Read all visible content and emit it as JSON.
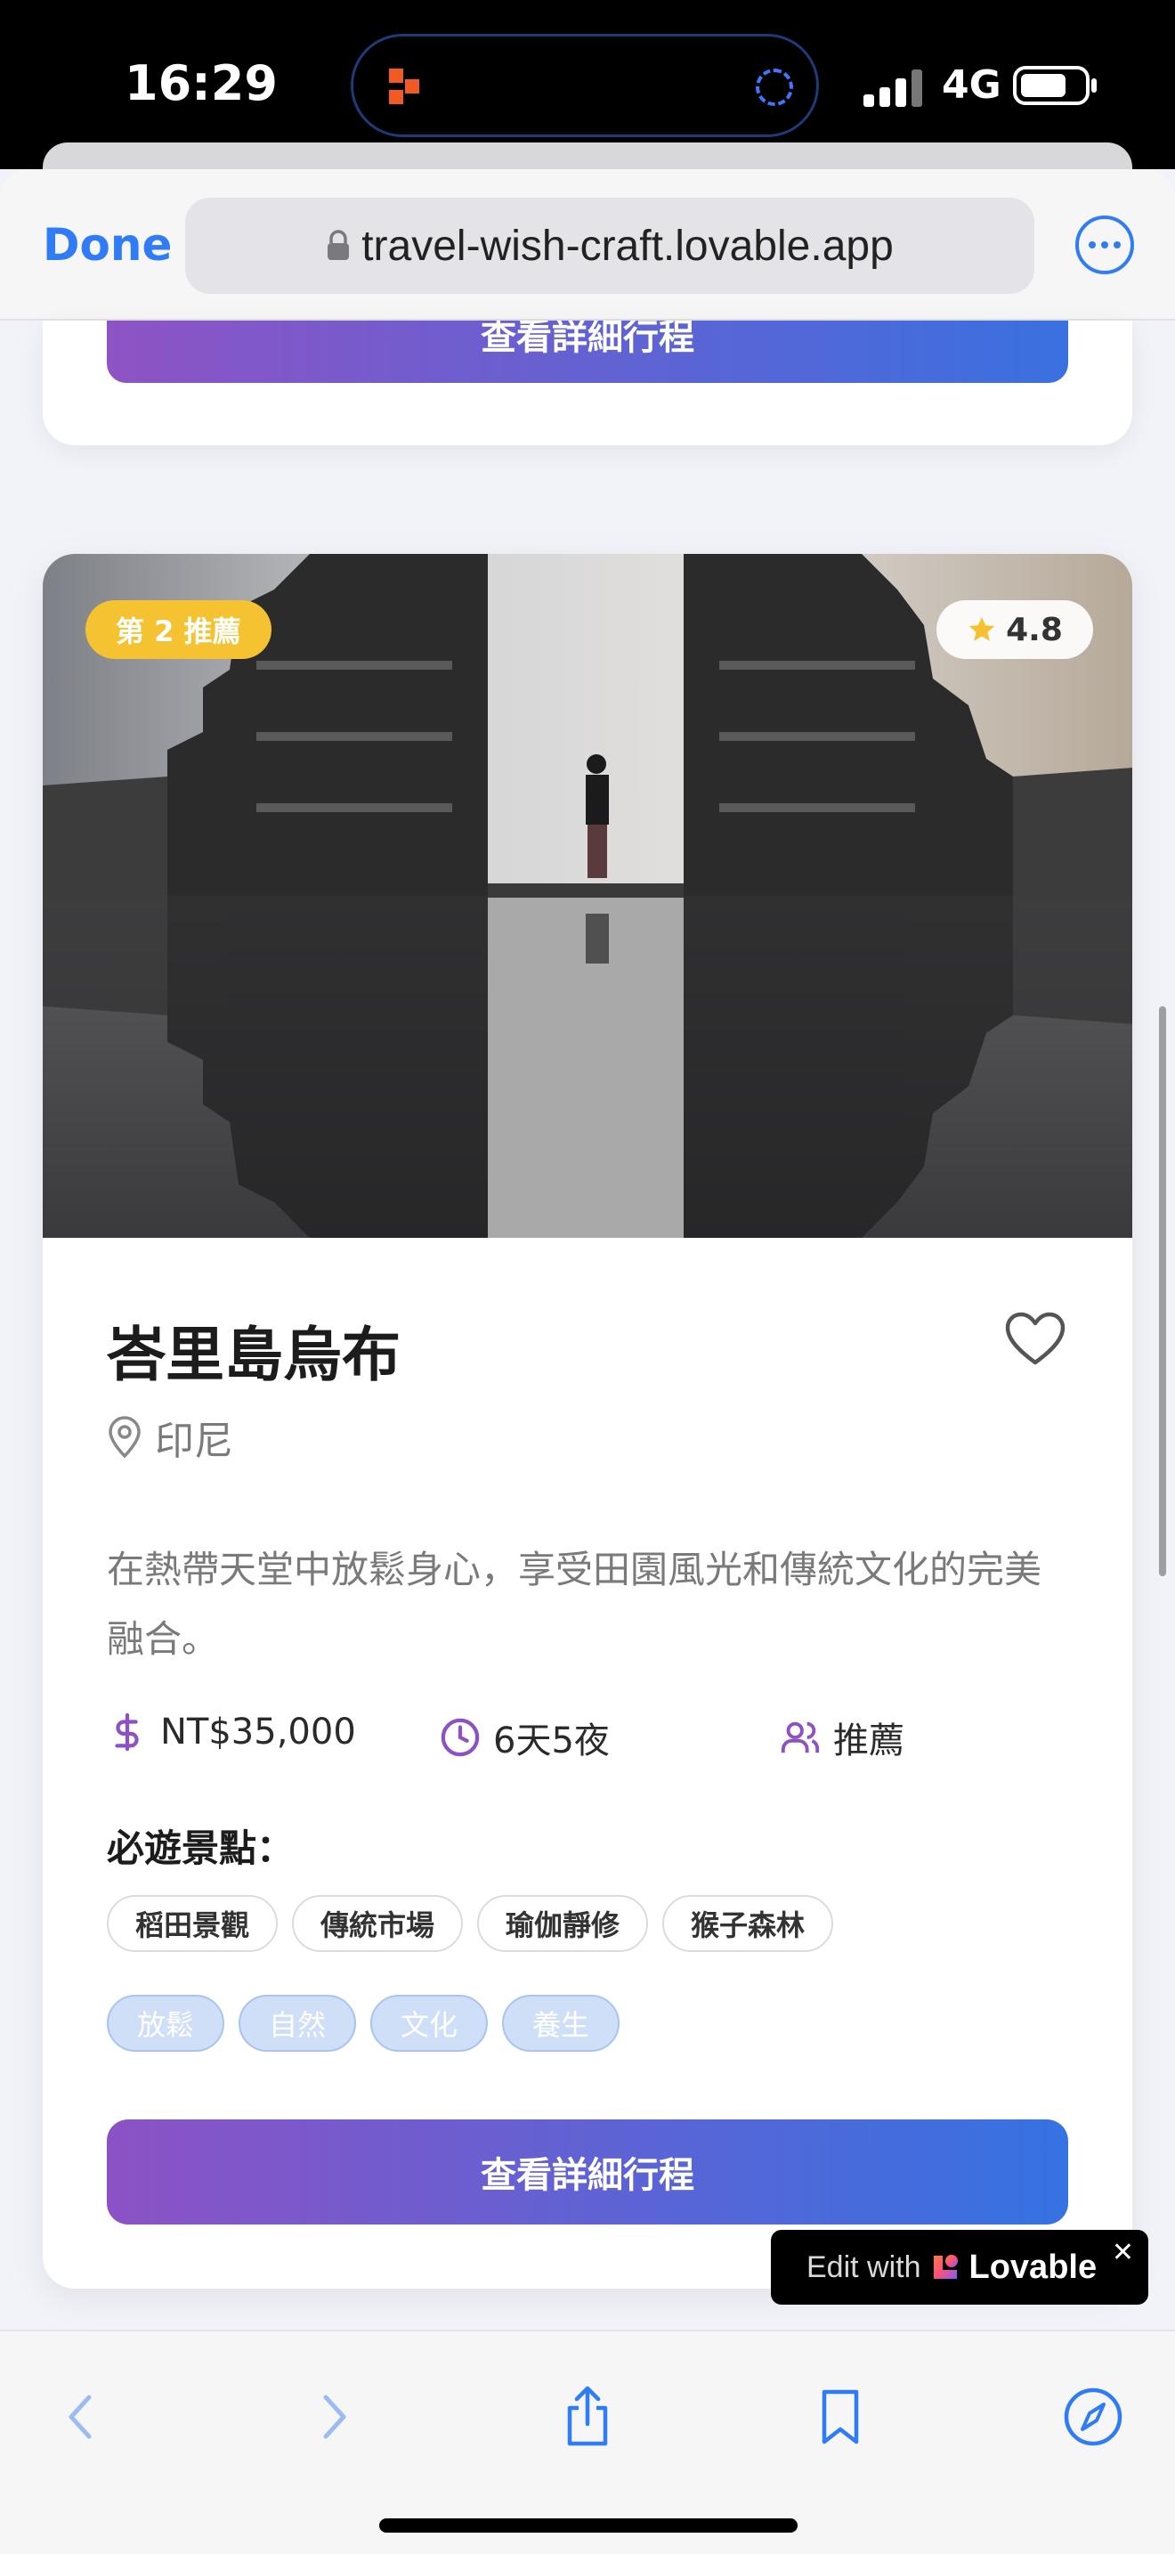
{
  "status_bar": {
    "time": "16:29",
    "network": "4G"
  },
  "browser": {
    "done_label": "Done",
    "url": "travel-wish-craft.lovable.app"
  },
  "previous_card": {
    "button_label": "查看詳細行程"
  },
  "card": {
    "rank_badge": "第 2 推薦",
    "rating": "4.8",
    "title": "峇里島烏布",
    "location": "印尼",
    "description": "在熱帶天堂中放鬆身心，享受田園風光和傳統文化的完美融合。",
    "price": "NT$35,000",
    "duration": "6天5夜",
    "audience": "推薦",
    "spots_title": "必遊景點：",
    "spots": [
      "稻田景觀",
      "傳統市場",
      "瑜伽靜修",
      "猴子森林"
    ],
    "tags": [
      "放鬆",
      "自然",
      "文化",
      "養生"
    ],
    "cta_label": "查看詳細行程"
  },
  "lovable_badge": {
    "edit_text": "Edit with",
    "brand": "Lovable",
    "close": "✕"
  },
  "colors": {
    "accent_blue": "#2f7cf6",
    "purple": "#8c52c5",
    "gradient_blue": "#3572e2",
    "rank_yellow": "#f5c232"
  }
}
